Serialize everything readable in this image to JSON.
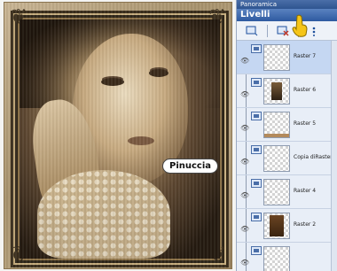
{
  "canvas": {
    "watermark": "Pinuccia"
  },
  "panel": {
    "top_title": "Panoramica",
    "layers_title": "Livelli",
    "toolbar": {
      "new_layer_icon": "new-layer-icon",
      "delete_icon": "delete-layer-icon",
      "properties_icon": "layer-properties-icon"
    },
    "layers": [
      {
        "name": "Raster 7",
        "selected": true,
        "thumb": "empty"
      },
      {
        "name": "Raster 6",
        "selected": false,
        "thumb": "figure"
      },
      {
        "name": "Raster 5",
        "selected": false,
        "thumb": "strip"
      },
      {
        "name": "Copia diRaster",
        "selected": false,
        "thumb": "empty"
      },
      {
        "name": "Raster 4",
        "selected": false,
        "thumb": "empty"
      },
      {
        "name": "Raster 2",
        "selected": false,
        "thumb": "brown"
      },
      {
        "name": "",
        "selected": false,
        "thumb": "empty"
      }
    ]
  },
  "colors": {
    "panel_header": "#2e5aa0",
    "selection": "#c5d7f2",
    "frame": "#a8936d"
  }
}
